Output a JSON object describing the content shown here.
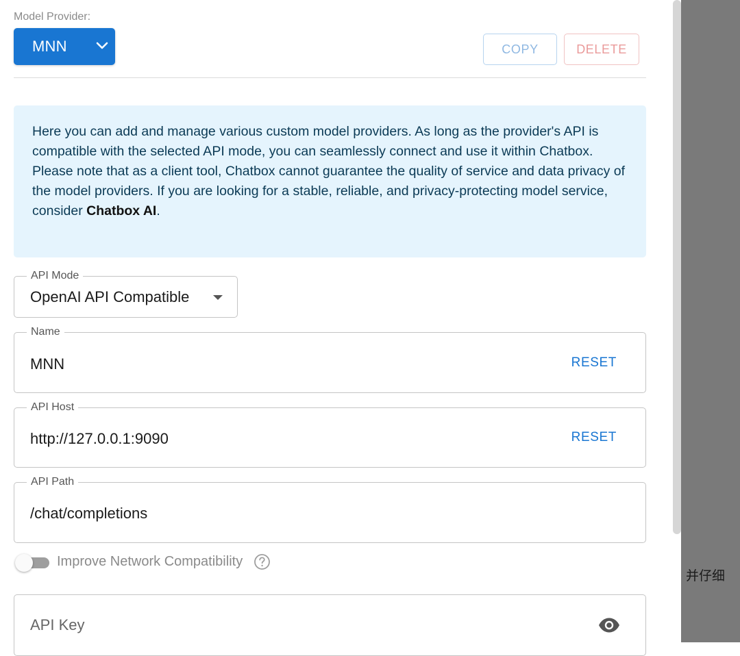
{
  "provider": {
    "label": "Model Provider:",
    "selected": "MNN"
  },
  "actions": {
    "copy": "COPY",
    "delete": "DELETE"
  },
  "info": {
    "paragraph1": "Here you can add and manage various custom model providers. As long as the provider's API is compatible with the selected API mode, you can seamlessly connect and use it within Chatbox.",
    "paragraph2_prefix": "Please note that as a client tool, Chatbox cannot guarantee the quality of service and data privacy of the model providers. If you are looking for a stable, reliable, and privacy-protecting model service, consider ",
    "paragraph2_link": "Chatbox AI",
    "paragraph2_suffix": "."
  },
  "fields": {
    "api_mode": {
      "label": "API Mode",
      "value": "OpenAI API Compatible"
    },
    "name": {
      "label": "Name",
      "value": "MNN",
      "reset": "RESET"
    },
    "api_host": {
      "label": "API Host",
      "value": "http://127.0.0.1:9090",
      "reset": "RESET"
    },
    "api_path": {
      "label": "API Path",
      "value": "/chat/completions"
    },
    "api_key": {
      "placeholder": "API Key"
    }
  },
  "network_toggle": {
    "label": "Improve Network Compatibility",
    "enabled": false
  },
  "background": {
    "text": "，并仔细"
  },
  "icons": {
    "dropdown": "chevron-down-icon",
    "help": "help-circle-icon",
    "visibility": "eye-icon"
  },
  "colors": {
    "primary": "#1976d2",
    "info_bg": "#e5f4fd",
    "danger": "#ea9a9a"
  }
}
